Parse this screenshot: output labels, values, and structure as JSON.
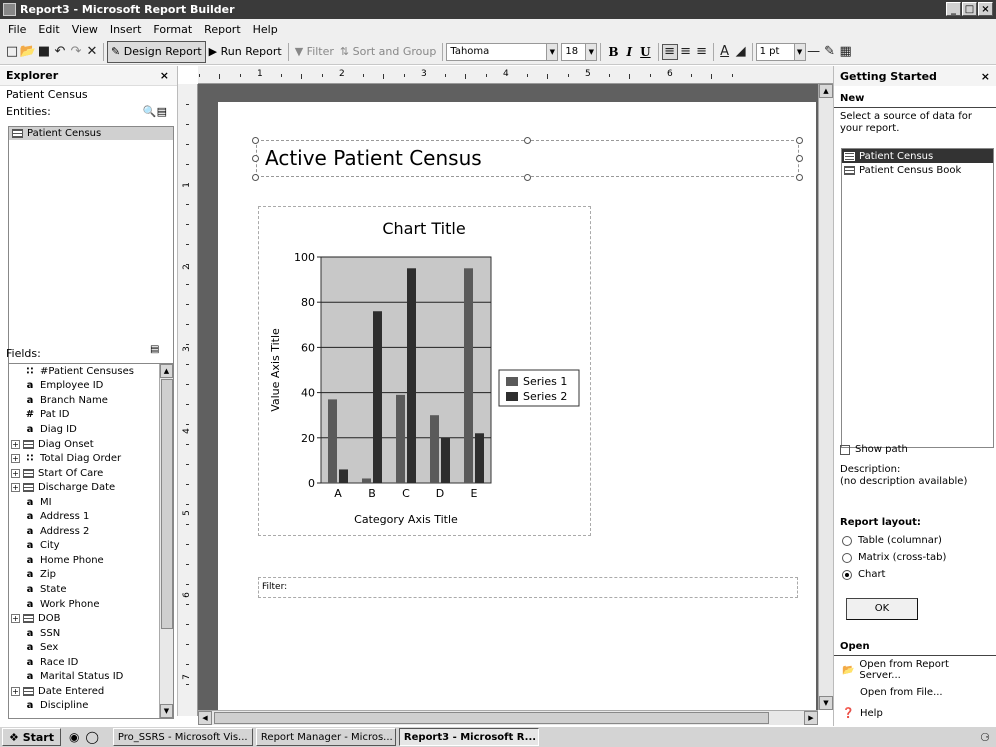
{
  "window": {
    "title": "Report3 - Microsoft Report Builder",
    "min": "_",
    "max": "□",
    "close": "×"
  },
  "menu": [
    "File",
    "Edit",
    "View",
    "Insert",
    "Format",
    "Report",
    "Help"
  ],
  "toolbar": {
    "design": "Design Report",
    "run": "Run Report",
    "filter": "Filter",
    "sort": "Sort and Group",
    "font": "Tahoma",
    "size": "18",
    "bold": "B",
    "italic": "I",
    "underline": "U",
    "linewidth": "1 pt"
  },
  "explorer": {
    "title": "Explorer",
    "close": "×",
    "model": "Patient Census",
    "entities_label": "Entities:",
    "entities": [
      "Patient Census"
    ],
    "fields_label": "Fields:",
    "fields": [
      {
        "icon": "count",
        "label": "#Patient Censuses",
        "exp": false
      },
      {
        "icon": "text",
        "label": "Employee ID",
        "exp": false
      },
      {
        "icon": "text",
        "label": "Branch Name",
        "exp": false
      },
      {
        "icon": "num",
        "label": "Pat ID",
        "exp": false
      },
      {
        "icon": "text",
        "label": "Diag ID",
        "exp": false
      },
      {
        "icon": "date",
        "label": "Diag Onset",
        "exp": true
      },
      {
        "icon": "count",
        "label": "Total Diag Order",
        "exp": true
      },
      {
        "icon": "date",
        "label": "Start Of Care",
        "exp": true
      },
      {
        "icon": "date",
        "label": "Discharge Date",
        "exp": true
      },
      {
        "icon": "text",
        "label": "MI",
        "exp": false
      },
      {
        "icon": "text",
        "label": "Address 1",
        "exp": false
      },
      {
        "icon": "text",
        "label": "Address 2",
        "exp": false
      },
      {
        "icon": "text",
        "label": "City",
        "exp": false
      },
      {
        "icon": "text",
        "label": "Home Phone",
        "exp": false
      },
      {
        "icon": "text",
        "label": "Zip",
        "exp": false
      },
      {
        "icon": "text",
        "label": "State",
        "exp": false
      },
      {
        "icon": "text",
        "label": "Work Phone",
        "exp": false
      },
      {
        "icon": "date",
        "label": "DOB",
        "exp": true
      },
      {
        "icon": "text",
        "label": "SSN",
        "exp": false
      },
      {
        "icon": "text",
        "label": "Sex",
        "exp": false
      },
      {
        "icon": "text",
        "label": "Race ID",
        "exp": false
      },
      {
        "icon": "text",
        "label": "Marital Status ID",
        "exp": false
      },
      {
        "icon": "date",
        "label": "Date Entered",
        "exp": true
      },
      {
        "icon": "text",
        "label": "Discipline",
        "exp": false
      }
    ]
  },
  "ruler": {
    "marks": [
      "1",
      "2",
      "3",
      "4",
      "5",
      "6"
    ],
    "vmarks": [
      "1",
      "2",
      "3",
      "4",
      "5",
      "6",
      "7"
    ]
  },
  "report": {
    "title": "Active Patient Census",
    "filter_label": "Filter:"
  },
  "chart_data": {
    "type": "bar",
    "title": "Chart Title",
    "xlabel": "Category Axis Title",
    "ylabel": "Value Axis Title",
    "categories": [
      "A",
      "B",
      "C",
      "D",
      "E"
    ],
    "series": [
      {
        "name": "Series 1",
        "values": [
          37,
          2,
          39,
          30,
          95
        ]
      },
      {
        "name": "Series 2",
        "values": [
          6,
          76,
          95,
          20,
          22
        ]
      }
    ],
    "ylim": [
      0,
      100
    ],
    "yticks": [
      "0",
      "20",
      "40",
      "60",
      "80",
      "100"
    ],
    "colors": [
      "#5a5a5a",
      "#2e2e2e"
    ],
    "grid": true,
    "legend": "right"
  },
  "getting_started": {
    "title": "Getting Started",
    "close": "×",
    "new_label": "New",
    "prompt": "Select a source of data for your report.",
    "sources": [
      "Patient Census",
      "Patient Census Book"
    ],
    "show_path": "Show path",
    "description_label": "Description:",
    "description": "(no description available)",
    "layout_label": "Report layout:",
    "layouts": [
      "Table (columnar)",
      "Matrix (cross-tab)",
      "Chart"
    ],
    "ok": "OK",
    "open_label": "Open",
    "open_server": "Open from Report Server...",
    "open_file": "Open from File...",
    "help": "Help"
  },
  "taskbar": {
    "start": "Start",
    "tasks": [
      "Pro_SSRS - Microsoft Vis...",
      "Report Manager - Micros...",
      "Report3 - Microsoft R..."
    ]
  }
}
